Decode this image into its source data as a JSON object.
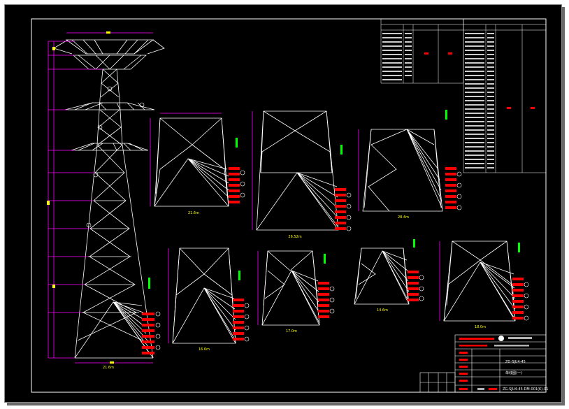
{
  "canvas": {
    "background": "#000000",
    "line_color": "#ffffff",
    "dim_color": "#ff00ff",
    "note_color": "#ff0000",
    "tag_color": "#ffff00",
    "ref_color": "#00ff00"
  },
  "base_labels": {
    "main": "21.6m",
    "s1": "21.6m",
    "s2": "26.52m",
    "s3": "28.4m",
    "s4": "16.6m",
    "s5": "17.0m",
    "s6": "14.6m",
    "s7": "18.0m"
  },
  "title_block": {
    "drawing_name": "ZG-SJU4-45",
    "sheet_label": "单线图(一)",
    "drawing_no": "ZG-SJU4-45-DM-001(K)-01"
  }
}
